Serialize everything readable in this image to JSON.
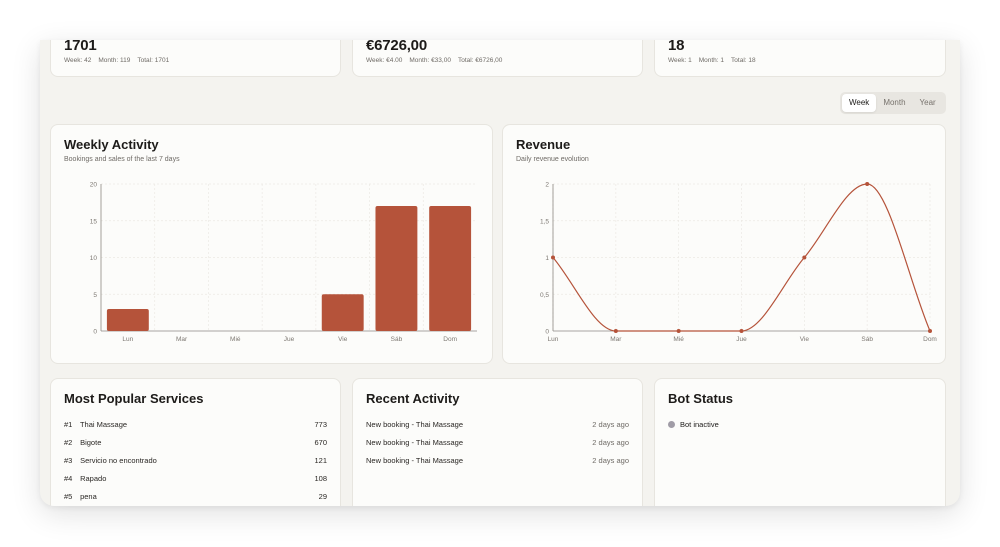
{
  "stats": [
    {
      "value": "1701",
      "sub": [
        "Week: 42",
        "Month: 119",
        "Total: 1701"
      ]
    },
    {
      "value": "€6726,00",
      "sub": [
        "Week: €4.00",
        "Month: €33,00",
        "Total: €6726,00"
      ]
    },
    {
      "value": "18",
      "sub": [
        "Week: 1",
        "Month: 1",
        "Total: 18"
      ]
    }
  ],
  "period_toggle": {
    "options": [
      "Week",
      "Month",
      "Year"
    ],
    "selected": "Week"
  },
  "weekly_activity": {
    "title": "Weekly Activity",
    "subtitle": "Bookings and sales of the last 7 days"
  },
  "revenue": {
    "title": "Revenue",
    "subtitle": "Daily revenue evolution"
  },
  "popular_services": {
    "title": "Most Popular Services",
    "items": [
      {
        "rank": "#1",
        "name": "Thai Massage",
        "value": "773"
      },
      {
        "rank": "#2",
        "name": "Bigote",
        "value": "670"
      },
      {
        "rank": "#3",
        "name": "Servicio no encontrado",
        "value": "121"
      },
      {
        "rank": "#4",
        "name": "Rapado",
        "value": "108"
      },
      {
        "rank": "#5",
        "name": "pena",
        "value": "29"
      }
    ]
  },
  "recent_activity": {
    "title": "Recent Activity",
    "items": [
      {
        "text": "New booking - Thai Massage",
        "time": "2 days ago"
      },
      {
        "text": "New booking - Thai Massage",
        "time": "2 days ago"
      },
      {
        "text": "New booking - Thai Massage",
        "time": "2 days ago"
      }
    ]
  },
  "bot_status": {
    "title": "Bot Status",
    "status": "Bot inactive",
    "status_color": "#a09ca6"
  },
  "accent_color": "#b5533a",
  "chart_data": [
    {
      "type": "bar",
      "categories": [
        "Lun",
        "Mar",
        "Mié",
        "Jue",
        "Vie",
        "Sáb",
        "Dom"
      ],
      "values": [
        3,
        0,
        0,
        0,
        5,
        17,
        17
      ],
      "ylim": [
        0,
        20
      ],
      "yticks": [
        0,
        5,
        10,
        15,
        20
      ],
      "grid": true,
      "color": "#b5533a"
    },
    {
      "type": "line",
      "categories": [
        "Lun",
        "Mar",
        "Mié",
        "Jue",
        "Vie",
        "Sáb",
        "Dom"
      ],
      "values": [
        1,
        0,
        0,
        0,
        1,
        2,
        0
      ],
      "ylim": [
        0,
        2
      ],
      "yticks": [
        0,
        0.5,
        1,
        1.5,
        2
      ],
      "ytick_labels": [
        "0",
        "0,5",
        "1",
        "1,5",
        "2"
      ],
      "grid": true,
      "smooth": true,
      "color": "#b5533a"
    }
  ]
}
